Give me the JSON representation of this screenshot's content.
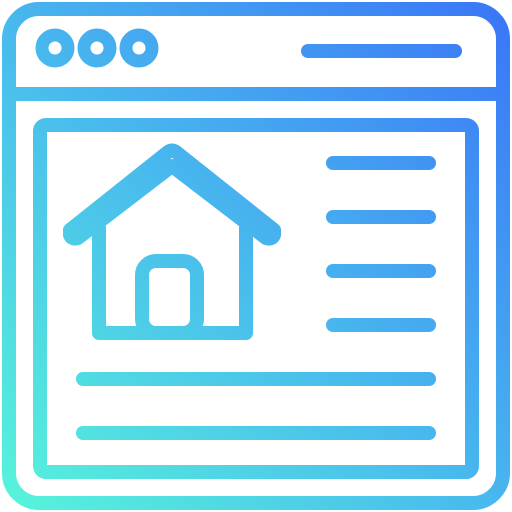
{
  "icon": {
    "name": "homepage-browser-icon",
    "gradient": {
      "start": "#57f5da",
      "mid": "#48b7ee",
      "end": "#3a74f7"
    }
  },
  "browser_window": {
    "control_dots": [
      "dot",
      "dot",
      "dot"
    ],
    "address_bar": "line",
    "content_panel": {
      "image": "house-icon",
      "side_lines": 4,
      "bottom_lines": 2
    }
  }
}
